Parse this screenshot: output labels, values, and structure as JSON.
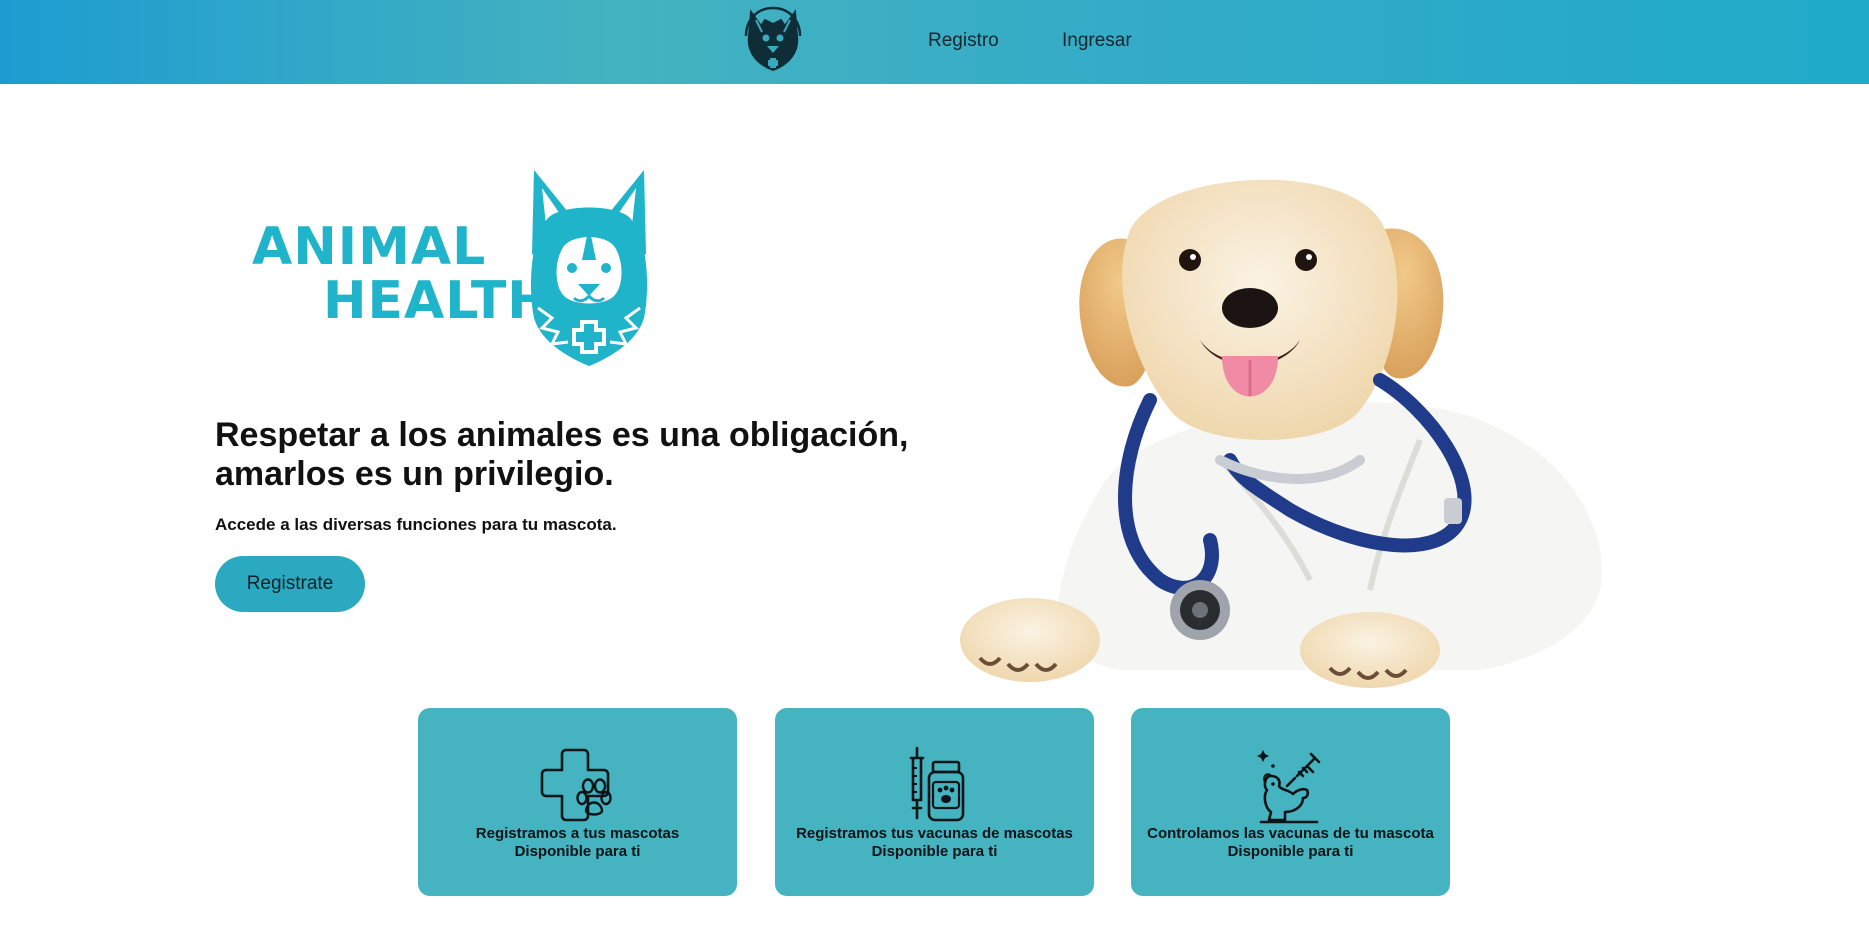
{
  "header": {
    "logo_icon": "dog-medical-logo-icon",
    "nav": [
      {
        "label": "Registro"
      },
      {
        "label": "Ingresar"
      }
    ]
  },
  "hero": {
    "brand_line1": "ANIMAL",
    "brand_line2": "HEALTH",
    "brand_icon": "dog-head-cross-icon",
    "title_line1": "Respetar a los animales es una obligación,",
    "title_line2": "amarlos es un privilegio.",
    "subtitle": "Accede a las diversas funciones para tu mascota.",
    "cta_label": "Registrate",
    "image": "puppy-with-stethoscope"
  },
  "features": [
    {
      "icon": "paw-cross-icon",
      "title": "Registramos a tus mascotas",
      "caption": "Disponible para ti"
    },
    {
      "icon": "syringe-bottle-icon",
      "title": "Registramos tus vacunas de mascotas",
      "caption": "Disponible para ti"
    },
    {
      "icon": "dog-syringe-icon",
      "title": "Controlamos las vacunas de tu mascota",
      "caption": "Disponible para ti"
    }
  ],
  "colors": {
    "header_start": "#1e9cd1",
    "header_end": "#1faac9",
    "brand": "#1fb4c9",
    "button": "#2aa9c0",
    "card": "#45b3c0"
  }
}
